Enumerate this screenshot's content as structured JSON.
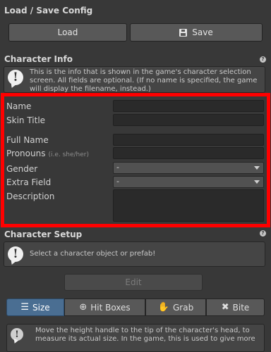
{
  "load_save": {
    "title": "Load / Save Config",
    "load_label": "Load",
    "save_label": "Save"
  },
  "character_info": {
    "title": "Character Info",
    "info_text": "This is the info that is shown in the game's character selection screen. All fields are optional. (If no name is specified, the game will display the filename, instead.)",
    "fields": {
      "name_label": "Name",
      "skin_title_label": "Skin Title",
      "full_name_label": "Full Name",
      "pronouns_label": "Pronouns",
      "pronouns_hint": "(i.e. she/her)",
      "gender_label": "Gender",
      "gender_value": "-",
      "extra_field_label": "Extra Field",
      "extra_field_value": "-",
      "description_label": "Description"
    }
  },
  "character_setup": {
    "title": "Character Setup",
    "info_text": "Select a character object or prefab!",
    "edit_label": "Edit",
    "tabs": [
      {
        "label": "Size",
        "icon": "ruler-icon",
        "active": true
      },
      {
        "label": "Hit Boxes",
        "icon": "crosshair-icon",
        "active": false
      },
      {
        "label": "Grab",
        "icon": "hand-icon",
        "active": false
      },
      {
        "label": "Bite",
        "icon": "tools-icon",
        "active": false
      }
    ],
    "size_help": "Move the height handle to the tip of the character's head, to measure its actual size. In the game, this is used to give more"
  },
  "colors": {
    "background": "#383838",
    "highlight_frame": "#ff0000",
    "active_tab": "#4a6e92"
  }
}
